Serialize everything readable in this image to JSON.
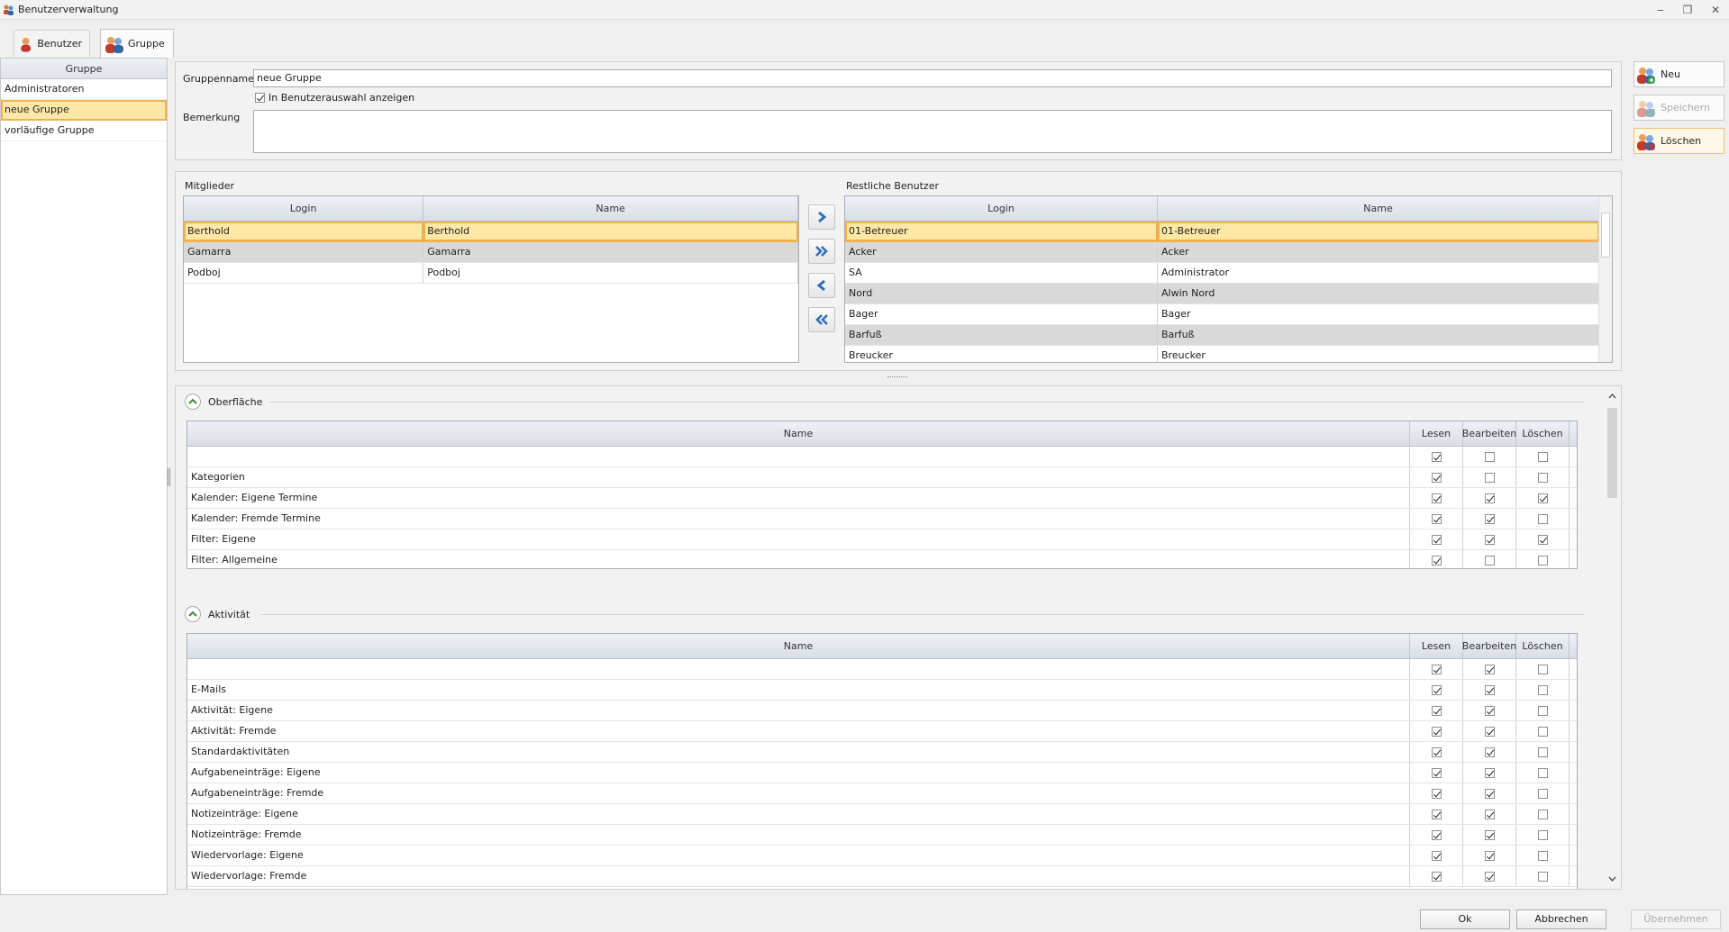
{
  "window": {
    "title": "Benutzerverwaltung",
    "min": "‒",
    "restore": "❐",
    "close": "✕"
  },
  "tabs": [
    {
      "label": "Benutzer"
    },
    {
      "label": "Gruppe"
    }
  ],
  "groups": {
    "header": "Gruppe",
    "items": [
      "Administratoren",
      "neue Gruppe",
      "vorläufige Gruppe"
    ],
    "selected": 1
  },
  "form": {
    "name_label": "Gruppenname",
    "name_value": "neue Gruppe",
    "show_in_selection_label": "In Benutzerauswahl anzeigen",
    "show_in_selection_checked": true,
    "remark_label": "Bemerkung",
    "remark_value": ""
  },
  "members": {
    "title": "Mitglieder",
    "columns": [
      "Login",
      "Name"
    ],
    "rows": [
      [
        "Berthold",
        "Berthold"
      ],
      [
        "Gamarra",
        "Gamarra"
      ],
      [
        "Podboj",
        "Podboj"
      ]
    ]
  },
  "others": {
    "title": "Restliche Benutzer",
    "columns": [
      "Login",
      "Name"
    ],
    "rows": [
      [
        "01-Betreuer",
        "01-Betreuer"
      ],
      [
        "Acker",
        "Acker"
      ],
      [
        "SA",
        "Administrator"
      ],
      [
        "Nord",
        "Alwin Nord"
      ],
      [
        "Bager",
        "Bager"
      ],
      [
        "Barfuß",
        "Barfuß"
      ],
      [
        "Breucker",
        "Breucker"
      ]
    ]
  },
  "transfer_buttons": [
    "arrow-right-icon",
    "double-arrow-right-icon",
    "arrow-left-icon",
    "double-arrow-left-icon"
  ],
  "permissions": {
    "columns": [
      "Name",
      "Lesen",
      "Bearbeiten",
      "Löschen"
    ],
    "sections": [
      {
        "title": "Oberfläche",
        "rows": [
          {
            "name": "",
            "v": [
              true,
              false,
              false
            ]
          },
          {
            "name": "Kategorien",
            "v": [
              true,
              false,
              false
            ]
          },
          {
            "name": "Kalender: Eigene Termine",
            "v": [
              true,
              true,
              true
            ]
          },
          {
            "name": "Kalender: Fremde Termine",
            "v": [
              true,
              true,
              false
            ]
          },
          {
            "name": "Filter: Eigene",
            "v": [
              true,
              true,
              true
            ]
          },
          {
            "name": "Filter: Allgemeine",
            "v": [
              true,
              false,
              false
            ]
          }
        ]
      },
      {
        "title": "Aktivität",
        "rows": [
          {
            "name": "",
            "v": [
              true,
              true,
              false
            ]
          },
          {
            "name": "E-Mails",
            "v": [
              true,
              true,
              false
            ]
          },
          {
            "name": "Aktivität: Eigene",
            "v": [
              true,
              true,
              false
            ]
          },
          {
            "name": "Aktivität: Fremde",
            "v": [
              true,
              true,
              false
            ]
          },
          {
            "name": "Standardaktivitäten",
            "v": [
              true,
              true,
              false
            ]
          },
          {
            "name": "Aufgabeneinträge: Eigene",
            "v": [
              true,
              true,
              false
            ]
          },
          {
            "name": "Aufgabeneinträge: Fremde",
            "v": [
              true,
              true,
              false
            ]
          },
          {
            "name": "Notizeinträge: Eigene",
            "v": [
              true,
              true,
              false
            ]
          },
          {
            "name": "Notizeinträge: Fremde",
            "v": [
              true,
              true,
              false
            ]
          },
          {
            "name": "Wiedervorlage: Eigene",
            "v": [
              true,
              true,
              false
            ]
          },
          {
            "name": "Wiedervorlage: Fremde",
            "v": [
              true,
              true,
              false
            ]
          }
        ]
      }
    ]
  },
  "actions": {
    "new": "Neu",
    "save": "Speichern",
    "delete": "Löschen"
  },
  "footer": {
    "ok": "Ok",
    "cancel": "Abbrechen",
    "apply": "Übernehmen"
  },
  "colors": {
    "selection": "#ffe8a6",
    "selection_border": "#f0b24e",
    "arrow": "#2f6fb7"
  }
}
